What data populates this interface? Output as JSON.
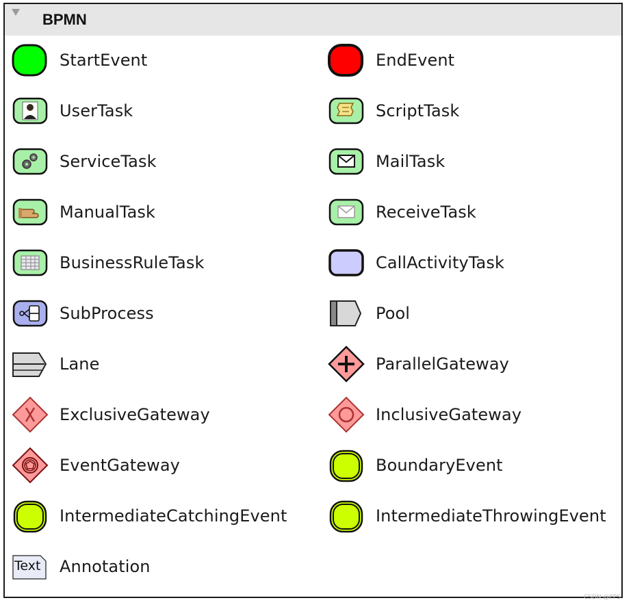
{
  "panel": {
    "title": "BPMN"
  },
  "items": [
    {
      "label": "StartEvent",
      "icon": "start-event-icon"
    },
    {
      "label": "EndEvent",
      "icon": "end-event-icon"
    },
    {
      "label": "UserTask",
      "icon": "user-task-icon"
    },
    {
      "label": "ScriptTask",
      "icon": "script-task-icon"
    },
    {
      "label": "ServiceTask",
      "icon": "service-task-icon"
    },
    {
      "label": "MailTask",
      "icon": "mail-task-icon"
    },
    {
      "label": "ManualTask",
      "icon": "manual-task-icon"
    },
    {
      "label": "ReceiveTask",
      "icon": "receive-task-icon"
    },
    {
      "label": "BusinessRuleTask",
      "icon": "business-rule-task-icon"
    },
    {
      "label": "CallActivityTask",
      "icon": "call-activity-task-icon"
    },
    {
      "label": "SubProcess",
      "icon": "sub-process-icon"
    },
    {
      "label": "Pool",
      "icon": "pool-icon"
    },
    {
      "label": "Lane",
      "icon": "lane-icon"
    },
    {
      "label": "ParallelGateway",
      "icon": "parallel-gateway-icon"
    },
    {
      "label": "ExclusiveGateway",
      "icon": "exclusive-gateway-icon"
    },
    {
      "label": "InclusiveGateway",
      "icon": "inclusive-gateway-icon"
    },
    {
      "label": "EventGateway",
      "icon": "event-gateway-icon"
    },
    {
      "label": "BoundaryEvent",
      "icon": "boundary-event-icon"
    },
    {
      "label": "IntermediateCatchingEvent",
      "icon": "intermediate-catching-event-icon"
    },
    {
      "label": "IntermediateThrowingEvent",
      "icon": "intermediate-throwing-event-icon"
    },
    {
      "label": "Annotation",
      "icon": "annotation-icon",
      "icon_text": "Text"
    }
  ],
  "colors": {
    "start": "#00ff00",
    "end": "#ff0000",
    "task": "#a8f0a8",
    "call_activity": "#ccccff",
    "subprocess": "#aab0ee",
    "gateway": "#ff9a9a",
    "event_yellow": "#ccff00"
  },
  "watermark": "CSDN @PPS"
}
